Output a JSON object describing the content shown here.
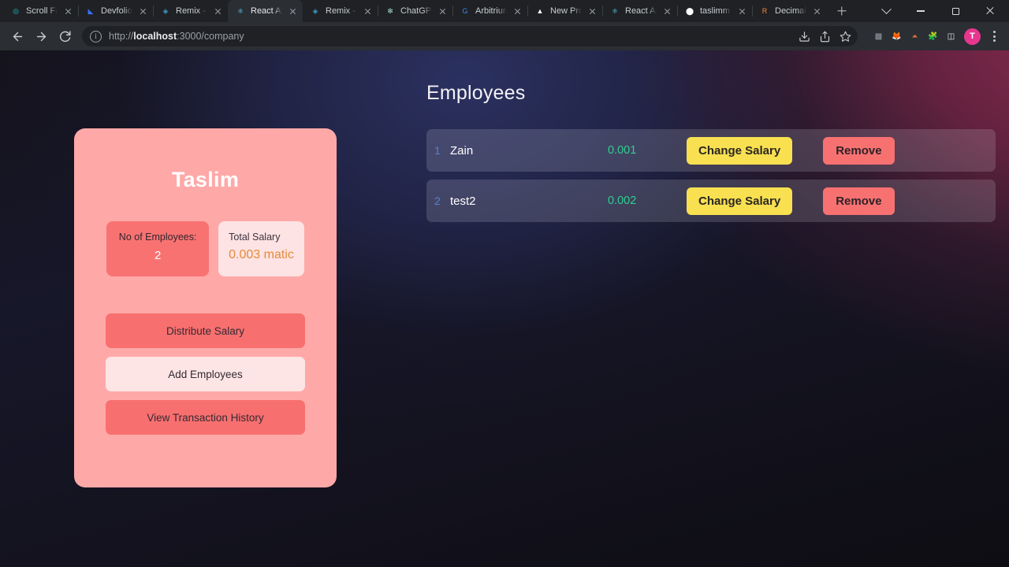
{
  "browser": {
    "tabs": [
      {
        "title": "Scroll Fa",
        "favicon": "scroll-circle-icon",
        "favicon_color": "#16c8d6",
        "favicon_glyph": "◎",
        "active": false
      },
      {
        "title": "Devfolio",
        "favicon": "devfolio-icon",
        "favicon_color": "#3770ff",
        "favicon_glyph": "◣",
        "active": false
      },
      {
        "title": "Remix - ",
        "favicon": "remix-icon",
        "favicon_color": "#3b9bd1",
        "favicon_glyph": "◈",
        "active": false
      },
      {
        "title": "React Ap",
        "favicon": "react-icon",
        "favicon_color": "#61dafb",
        "favicon_glyph": "⚛",
        "active": true
      },
      {
        "title": "Remix - ",
        "favicon": "remix-icon",
        "favicon_color": "#3b9bd1",
        "favicon_glyph": "◈",
        "active": false
      },
      {
        "title": "ChatGPT",
        "favicon": "chatgpt-icon",
        "favicon_color": "#9fd8c8",
        "favicon_glyph": "✻",
        "active": false
      },
      {
        "title": "Arbitrium",
        "favicon": "google-icon",
        "favicon_color": "#4285f4",
        "favicon_glyph": "G",
        "active": false
      },
      {
        "title": "New Pro",
        "favicon": "vercel-triangle-icon",
        "favicon_color": "#ffffff",
        "favicon_glyph": "▲",
        "active": false
      },
      {
        "title": "React Ap",
        "favicon": "react-icon",
        "favicon_color": "#61dafb",
        "favicon_glyph": "⚛",
        "active": false
      },
      {
        "title": "taslimm",
        "favicon": "github-icon",
        "favicon_color": "#ffffff",
        "favicon_glyph": "⬤",
        "active": false
      },
      {
        "title": "Decimal",
        "favicon": "r-letter-icon",
        "favicon_color": "#f0883e",
        "favicon_glyph": "R",
        "active": false
      }
    ],
    "new_tab_label": "+",
    "window_controls": {
      "tab_search": "tab-search-chevron",
      "minimize": "minimize",
      "maximize": "maximize",
      "close": "close"
    },
    "nav": {
      "back": "back-arrow-icon",
      "forward": "forward-arrow-icon",
      "reload": "reload-icon"
    },
    "omnibox": {
      "site_info_glyph": "i",
      "url_prefix": "http://",
      "url_host": "localhost",
      "url_suffix": ":3000/company",
      "url_full": "http://localhost:3000/company",
      "actions": [
        "install-app-icon",
        "share-icon",
        "bookmark-star-icon"
      ]
    },
    "extensions": [
      {
        "name": "gray-square-extension-icon",
        "glyph": "▩",
        "color": "#9aa0a6"
      },
      {
        "name": "metamask-fox-icon",
        "glyph": "🦊",
        "color": "#f6851b"
      },
      {
        "name": "phantom-wallet-icon",
        "glyph": "⏶",
        "color": "#d9703a"
      },
      {
        "name": "extensions-puzzle-icon",
        "glyph": "🧩",
        "color": "#d6d8da"
      },
      {
        "name": "sidepanel-icon",
        "glyph": "◫",
        "color": "#e8eaed"
      }
    ],
    "profile_initial": "T",
    "menu": "three-dot-menu"
  },
  "colors": {
    "card_bg": "#ffa8a8",
    "accent_salmon": "#f86f6f",
    "accent_yellow": "#f8e050",
    "accent_green": "#2fcf90",
    "accent_blue_index": "#5b80cd",
    "salary_orange": "#e58a3c"
  },
  "company_card": {
    "name": "Taslim",
    "stats": [
      {
        "label": "No of Employees:",
        "value": "2",
        "style": "dark"
      },
      {
        "label": "Total Salary",
        "value": "0.003 matic",
        "style": "light"
      }
    ],
    "actions": [
      {
        "label": "Distribute Salary",
        "style": "solid",
        "name": "distribute-salary-button"
      },
      {
        "label": "Add Employees",
        "style": "light",
        "name": "add-employees-button"
      },
      {
        "label": "View Transaction History",
        "style": "solid",
        "name": "view-transaction-history-button"
      }
    ]
  },
  "employees_panel": {
    "title": "Employees",
    "change_salary_label": "Change Salary",
    "remove_label": "Remove",
    "rows": [
      {
        "index": "1",
        "name": "Zain",
        "salary": "0.001"
      },
      {
        "index": "2",
        "name": "test2",
        "salary": "0.002"
      }
    ]
  }
}
